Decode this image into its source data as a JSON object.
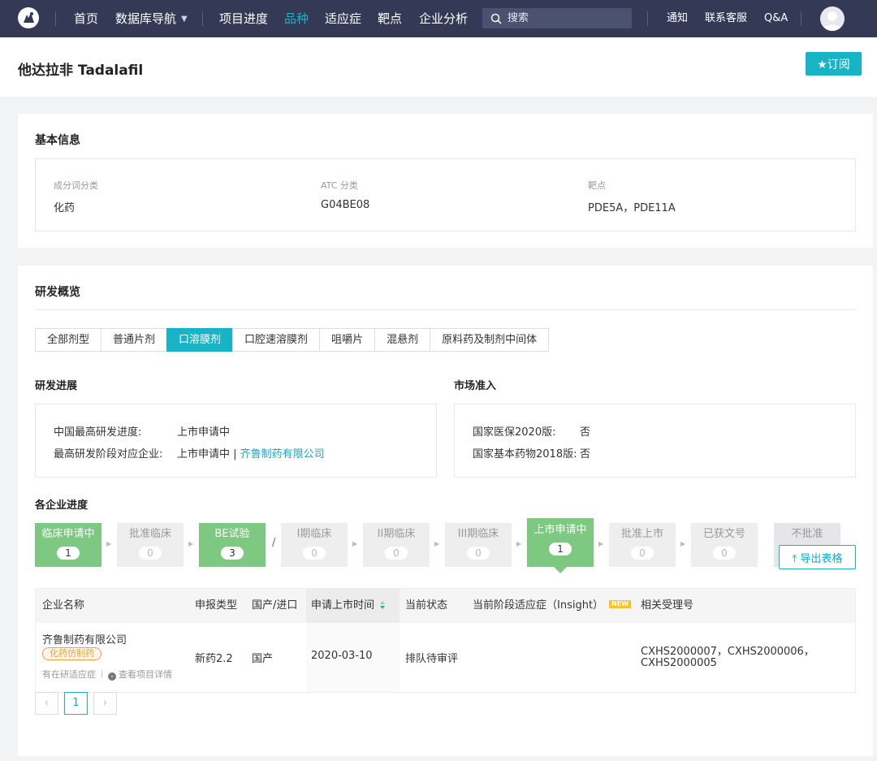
{
  "nav": {
    "items": [
      "首页",
      "数据库导航",
      "项目进度",
      "品种",
      "适应症",
      "靶点",
      "企业分析"
    ],
    "search_placeholder": "搜索",
    "right_items": [
      "通知",
      "联系客服",
      "Q&A"
    ],
    "active_item": "品种",
    "accent_color": "#17b3c6",
    "bar_color": "#343a55"
  },
  "page": {
    "title": "他达拉非 Tadalafil",
    "subscribe_label": "★订阅"
  },
  "basic_info": {
    "heading": "基本信息",
    "fields": [
      {
        "label": "成分词分类",
        "value": "化药"
      },
      {
        "label": "ATC 分类",
        "value": "G04BE08"
      },
      {
        "label": "靶点",
        "value": "PDE5A，PDE11A"
      }
    ]
  },
  "rd": {
    "heading": "研发概览",
    "tabs": [
      "全部剂型",
      "普通片剂",
      "口溶膜剂",
      "口腔速溶膜剂",
      "咀嚼片",
      "混悬剂",
      "原料药及制剂中间体"
    ],
    "active_tab": "口溶膜剂",
    "progress": {
      "heading": "研发进展",
      "rows": [
        {
          "key": "中国最高研发进度:",
          "value": "上市申请中"
        },
        {
          "key": "最高研发阶段对应企业:",
          "value": "上市申请中 | ",
          "link": "齐鲁制药有限公司"
        }
      ]
    },
    "market": {
      "heading": "市场准入",
      "rows": [
        {
          "key": "国家医保2020版:",
          "value": "否"
        },
        {
          "key": "国家基本药物2018版:",
          "value": "否"
        }
      ]
    }
  },
  "companies": {
    "heading": "各企业进度",
    "steps": [
      {
        "label": "临床申请中",
        "count": "1",
        "active": true
      },
      {
        "label": "批准临床",
        "count": "0",
        "active": false
      },
      {
        "label": "BE试验",
        "count": "3",
        "active": true
      },
      {
        "label": "I期临床",
        "count": "0",
        "active": false
      },
      {
        "label": "II期临床",
        "count": "0",
        "active": false
      },
      {
        "label": "III期临床",
        "count": "0",
        "active": false
      },
      {
        "label": "上市申请中",
        "count": "1",
        "active": true,
        "selected": true
      },
      {
        "label": "批准上市",
        "count": "0",
        "active": false
      },
      {
        "label": "已获文号",
        "count": "0",
        "active": false
      },
      {
        "label": "不批准",
        "count": "",
        "active": false
      }
    ],
    "slash": "/",
    "export_label": "导出表格",
    "table": {
      "columns": [
        "企业名称",
        "申报类型",
        "国产/进口",
        "申请上市时间",
        "当前状态",
        "当前阶段适应症（Insight）",
        "相关受理号"
      ],
      "new_badge": "NEW",
      "rows": [
        {
          "company": "齐鲁制药有限公司",
          "tag": "化药仿制药",
          "sub_link1": "有在研适应症",
          "sub_link2": "查看项目详情",
          "type": "新药2.2",
          "origin": "国产",
          "date": "2020-03-10",
          "status": "排队待审评",
          "indication": "",
          "accept_line1": "CXHS2000007，CXHS2000006，",
          "accept_line2": "CXHS2000005"
        }
      ]
    },
    "pager": {
      "prev": "‹",
      "page": "1",
      "next": "›"
    }
  }
}
